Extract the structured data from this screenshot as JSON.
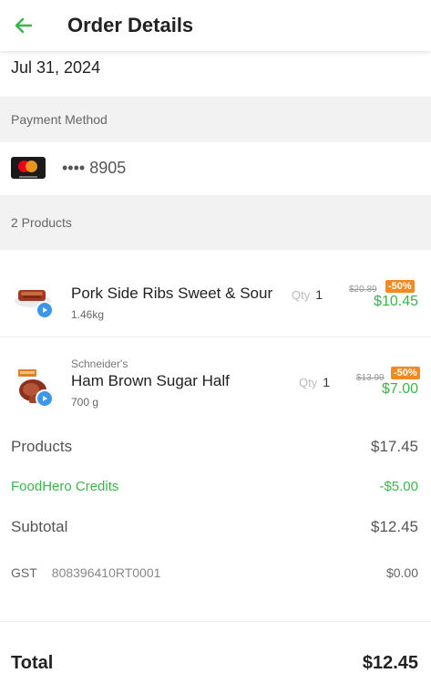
{
  "header": {
    "title": "Order Details"
  },
  "order": {
    "date": "Jul 31, 2024"
  },
  "payment": {
    "section_label": "Payment Method",
    "card_dots": "••••",
    "card_last4": "8905"
  },
  "products_section": {
    "label": "2 Products"
  },
  "products": [
    {
      "brand": "",
      "name": "Pork Side Ribs Sweet & Sour",
      "weight": "1.46kg",
      "qty_label": "Qty",
      "qty": "1",
      "old_price": "$20.89",
      "discount": "-50%",
      "price": "$10.45"
    },
    {
      "brand": "Schneider's",
      "name": "Ham Brown Sugar Half",
      "weight": "700 g",
      "qty_label": "Qty",
      "qty": "1",
      "old_price": "$13.99",
      "discount": "-50%",
      "price": "$7.00"
    }
  ],
  "summary": {
    "products_label": "Products",
    "products_value": "$17.45",
    "credits_label": "FoodHero Credits",
    "credits_value": "-$5.00",
    "subtotal_label": "Subtotal",
    "subtotal_value": "$12.45",
    "gst_label": "GST",
    "gst_number": "808396410RT0001",
    "gst_value": "$0.00",
    "total_label": "Total",
    "total_value": "$12.45"
  },
  "colors": {
    "accent_green": "#3bb54a",
    "discount_orange": "#f28a21",
    "badge_blue": "#3c96ea"
  }
}
